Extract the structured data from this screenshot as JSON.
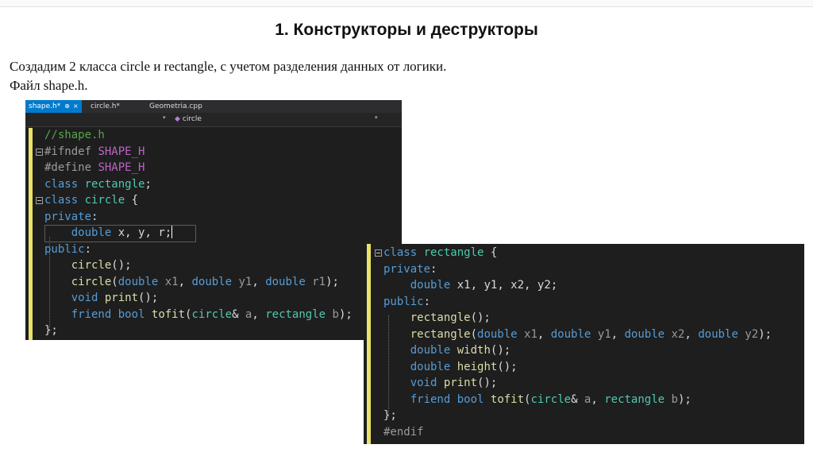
{
  "slide": {
    "title": "1. Конструкторы и деструкторы",
    "intro_line1": "Создадим 2 класса circle и rectangle, с учетом разделения данных от логики.",
    "intro_line2": "Файл shape.h."
  },
  "editor1": {
    "tabs": [
      {
        "label": "shape.h*",
        "pin": "⊕",
        "close": "×",
        "active": true
      },
      {
        "label": "circle.h*",
        "active": false
      },
      {
        "label": "Geometria.cpp",
        "active": false
      }
    ],
    "nav_member": "circle",
    "nav_member_icon": "class-member-icon",
    "lines": [
      {
        "t": [
          {
            "c": "cm",
            "v": "//shape.h"
          }
        ]
      },
      {
        "t": [
          {
            "c": "pp",
            "v": "#ifndef "
          },
          {
            "c": "mac",
            "v": "SHAPE_H"
          }
        ]
      },
      {
        "t": [
          {
            "c": "pp",
            "v": "#define "
          },
          {
            "c": "mac",
            "v": "SHAPE_H"
          }
        ]
      },
      {
        "t": [
          {
            "c": "kw",
            "v": "class "
          },
          {
            "c": "ty",
            "v": "rectangle"
          },
          {
            "c": "",
            "v": ";"
          }
        ]
      },
      {
        "t": [
          {
            "c": "kw",
            "v": "class "
          },
          {
            "c": "ty",
            "v": "circle"
          },
          {
            "c": "",
            "v": " {"
          }
        ]
      },
      {
        "t": [
          {
            "c": "kw",
            "v": "private"
          },
          {
            "c": "",
            "v": ":"
          }
        ]
      },
      {
        "t": [
          {
            "c": "",
            "v": "    "
          },
          {
            "c": "kw",
            "v": "double"
          },
          {
            "c": "",
            "v": " "
          },
          {
            "c": "va",
            "v": "x"
          },
          {
            "c": "",
            "v": ", "
          },
          {
            "c": "va",
            "v": "y"
          },
          {
            "c": "",
            "v": ", "
          },
          {
            "c": "va",
            "v": "r"
          },
          {
            "c": "",
            "v": ";"
          }
        ]
      },
      {
        "t": [
          {
            "c": "kw",
            "v": "public"
          },
          {
            "c": "",
            "v": ":"
          }
        ]
      },
      {
        "t": [
          {
            "c": "",
            "v": "    "
          },
          {
            "c": "fn",
            "v": "circle"
          },
          {
            "c": "",
            "v": "();"
          }
        ]
      },
      {
        "t": [
          {
            "c": "",
            "v": "    "
          },
          {
            "c": "fn",
            "v": "circle"
          },
          {
            "c": "",
            "v": "("
          },
          {
            "c": "kw",
            "v": "double"
          },
          {
            "c": "",
            "v": " "
          },
          {
            "c": "pa",
            "v": "x1"
          },
          {
            "c": "",
            "v": ", "
          },
          {
            "c": "kw",
            "v": "double"
          },
          {
            "c": "",
            "v": " "
          },
          {
            "c": "pa",
            "v": "y1"
          },
          {
            "c": "",
            "v": ", "
          },
          {
            "c": "kw",
            "v": "double"
          },
          {
            "c": "",
            "v": " "
          },
          {
            "c": "pa",
            "v": "r1"
          },
          {
            "c": "",
            "v": ");"
          }
        ]
      },
      {
        "t": [
          {
            "c": "",
            "v": "    "
          },
          {
            "c": "kw",
            "v": "void"
          },
          {
            "c": "",
            "v": " "
          },
          {
            "c": "fn",
            "v": "print"
          },
          {
            "c": "",
            "v": "();"
          }
        ]
      },
      {
        "t": [
          {
            "c": "",
            "v": "    "
          },
          {
            "c": "kw",
            "v": "friend"
          },
          {
            "c": "",
            "v": " "
          },
          {
            "c": "kw",
            "v": "bool"
          },
          {
            "c": "",
            "v": " "
          },
          {
            "c": "fn",
            "v": "tofit"
          },
          {
            "c": "",
            "v": "("
          },
          {
            "c": "ty",
            "v": "circle"
          },
          {
            "c": "",
            "v": "& "
          },
          {
            "c": "pa",
            "v": "a"
          },
          {
            "c": "",
            "v": ", "
          },
          {
            "c": "ty",
            "v": "rectangle"
          },
          {
            "c": "",
            "v": " "
          },
          {
            "c": "pa",
            "v": "b"
          },
          {
            "c": "",
            "v": ");"
          }
        ]
      },
      {
        "t": [
          {
            "c": "",
            "v": "};"
          }
        ]
      }
    ]
  },
  "editor2": {
    "lines": [
      {
        "t": [
          {
            "c": "kw",
            "v": "class "
          },
          {
            "c": "ty",
            "v": "rectangle"
          },
          {
            "c": "",
            "v": " {"
          }
        ]
      },
      {
        "t": [
          {
            "c": "kw",
            "v": "private"
          },
          {
            "c": "",
            "v": ":"
          }
        ]
      },
      {
        "t": [
          {
            "c": "",
            "v": "    "
          },
          {
            "c": "kw",
            "v": "double"
          },
          {
            "c": "",
            "v": " "
          },
          {
            "c": "va",
            "v": "x1"
          },
          {
            "c": "",
            "v": ", "
          },
          {
            "c": "va",
            "v": "y1"
          },
          {
            "c": "",
            "v": ", "
          },
          {
            "c": "va",
            "v": "x2"
          },
          {
            "c": "",
            "v": ", "
          },
          {
            "c": "va",
            "v": "y2"
          },
          {
            "c": "",
            "v": ";"
          }
        ]
      },
      {
        "t": [
          {
            "c": "kw",
            "v": "public"
          },
          {
            "c": "",
            "v": ":"
          }
        ]
      },
      {
        "t": [
          {
            "c": "",
            "v": "    "
          },
          {
            "c": "fn",
            "v": "rectangle"
          },
          {
            "c": "",
            "v": "();"
          }
        ]
      },
      {
        "t": [
          {
            "c": "",
            "v": "    "
          },
          {
            "c": "fn",
            "v": "rectangle"
          },
          {
            "c": "",
            "v": "("
          },
          {
            "c": "kw",
            "v": "double"
          },
          {
            "c": "",
            "v": " "
          },
          {
            "c": "pa",
            "v": "x1"
          },
          {
            "c": "",
            "v": ", "
          },
          {
            "c": "kw",
            "v": "double"
          },
          {
            "c": "",
            "v": " "
          },
          {
            "c": "pa",
            "v": "y1"
          },
          {
            "c": "",
            "v": ", "
          },
          {
            "c": "kw",
            "v": "double"
          },
          {
            "c": "",
            "v": " "
          },
          {
            "c": "pa",
            "v": "x2"
          },
          {
            "c": "",
            "v": ", "
          },
          {
            "c": "kw",
            "v": "double"
          },
          {
            "c": "",
            "v": " "
          },
          {
            "c": "pa",
            "v": "y2"
          },
          {
            "c": "",
            "v": ");"
          }
        ]
      },
      {
        "t": [
          {
            "c": "",
            "v": "    "
          },
          {
            "c": "kw",
            "v": "double"
          },
          {
            "c": "",
            "v": " "
          },
          {
            "c": "fn",
            "v": "width"
          },
          {
            "c": "",
            "v": "();"
          }
        ]
      },
      {
        "t": [
          {
            "c": "",
            "v": "    "
          },
          {
            "c": "kw",
            "v": "double"
          },
          {
            "c": "",
            "v": " "
          },
          {
            "c": "fn",
            "v": "height"
          },
          {
            "c": "",
            "v": "();"
          }
        ]
      },
      {
        "t": [
          {
            "c": "",
            "v": "    "
          },
          {
            "c": "kw",
            "v": "void"
          },
          {
            "c": "",
            "v": " "
          },
          {
            "c": "fn",
            "v": "print"
          },
          {
            "c": "",
            "v": "();"
          }
        ]
      },
      {
        "t": [
          {
            "c": "",
            "v": "    "
          },
          {
            "c": "kw",
            "v": "friend"
          },
          {
            "c": "",
            "v": " "
          },
          {
            "c": "kw",
            "v": "bool"
          },
          {
            "c": "",
            "v": " "
          },
          {
            "c": "fn",
            "v": "tofit"
          },
          {
            "c": "",
            "v": "("
          },
          {
            "c": "ty",
            "v": "circle"
          },
          {
            "c": "",
            "v": "& "
          },
          {
            "c": "pa",
            "v": "a"
          },
          {
            "c": "",
            "v": ", "
          },
          {
            "c": "ty",
            "v": "rectangle"
          },
          {
            "c": "",
            "v": " "
          },
          {
            "c": "pa",
            "v": "b"
          },
          {
            "c": "",
            "v": ");"
          }
        ]
      },
      {
        "t": [
          {
            "c": "",
            "v": "};"
          }
        ]
      },
      {
        "t": [
          {
            "c": "pp",
            "v": "#endif"
          }
        ]
      }
    ]
  },
  "colors": {
    "editor_bg": "#1e1e1e",
    "keyword": "#569cd6",
    "type": "#4ec9b0",
    "function": "#dcdcaa",
    "comment": "#57a64a",
    "macro": "#bd63c5",
    "change_bar": "#e8e16a",
    "active_tab": "#007acc"
  }
}
